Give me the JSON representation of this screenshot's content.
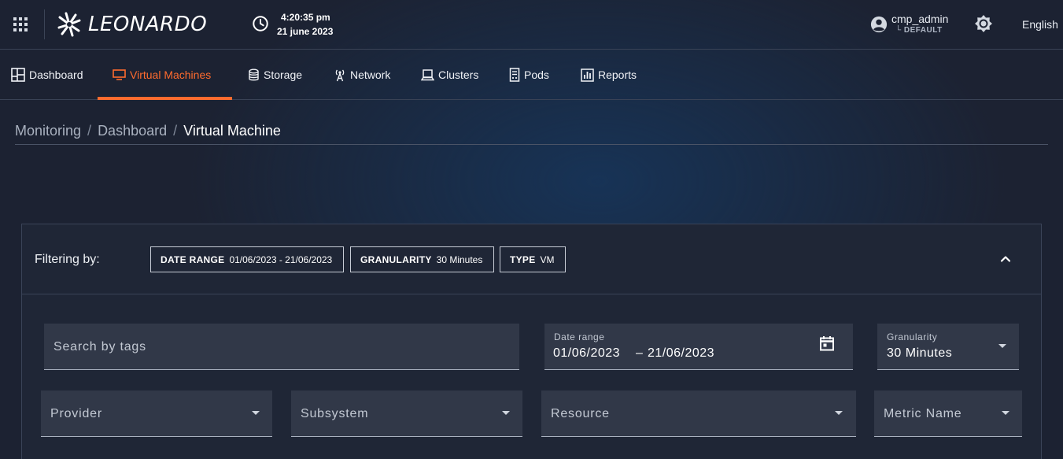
{
  "header": {
    "logo_text": "LEONARDO",
    "time": "4:20:35 pm",
    "date": "21 june 2023",
    "user_name": "cmp_admin",
    "user_role": "└ DEFAULT",
    "language": "English",
    "icons": [
      "apps-grid-icon",
      "leonardo-logo-icon",
      "clock-icon",
      "account-circle-icon",
      "theme-brightness-icon"
    ]
  },
  "nav": {
    "items": [
      {
        "label": "Dashboard",
        "icon": "dashboard-icon"
      },
      {
        "label": "Virtual Machines",
        "icon": "monitor-icon",
        "active": true
      },
      {
        "label": "Storage",
        "icon": "database-icon"
      },
      {
        "label": "Network",
        "icon": "antenna-icon"
      },
      {
        "label": "Clusters",
        "icon": "laptop-icon"
      },
      {
        "label": "Pods",
        "icon": "server-icon"
      },
      {
        "label": "Reports",
        "icon": "report-chart-icon"
      }
    ],
    "active_color": "#ff6b2e"
  },
  "breadcrumb": {
    "items": [
      "Monitoring",
      "Dashboard",
      "Virtual Machine"
    ],
    "separator": "/"
  },
  "filters": {
    "label": "Filtering by:",
    "chips": [
      {
        "key": "DATE RANGE",
        "value": "01/06/2023 - 21/06/2023"
      },
      {
        "key": "GRANULARITY",
        "value": "30 Minutes"
      },
      {
        "key": "TYPE",
        "value": "VM"
      }
    ],
    "search_placeholder": "Search by tags",
    "date_range": {
      "label": "Date range",
      "start": "01/06/2023",
      "separator": "–",
      "end": "21/06/2023"
    },
    "granularity": {
      "label": "Granularity",
      "value": "30 Minutes"
    },
    "provider_placeholder": "Provider",
    "subsystem_placeholder": "Subsystem",
    "resource_placeholder": "Resource",
    "metric_placeholder": "Metric Name"
  },
  "colors": {
    "background": "#1c2232",
    "panel": "#1f2636",
    "field": "#313848",
    "accent": "#ff6b2e"
  }
}
